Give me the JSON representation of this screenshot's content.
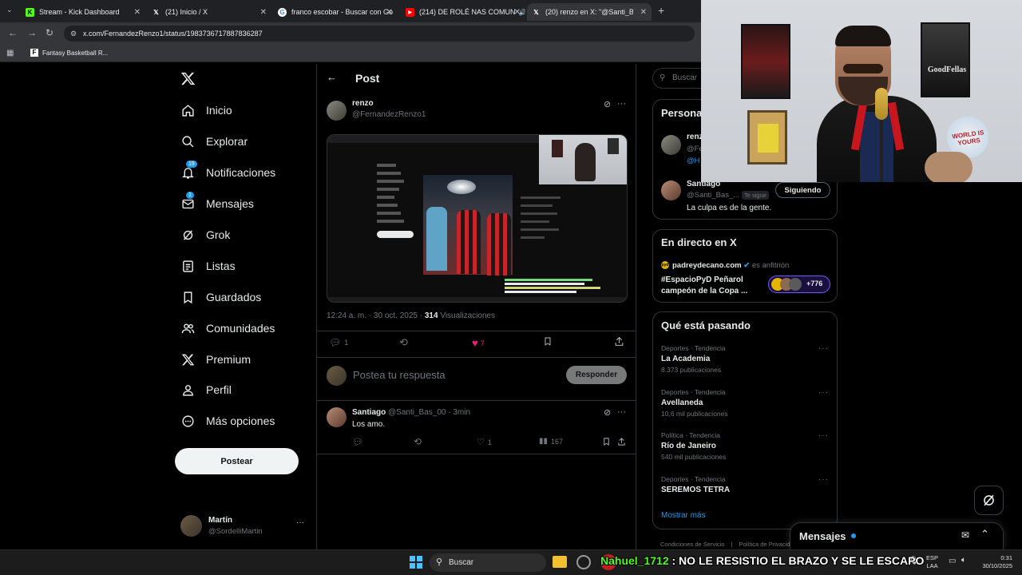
{
  "browser": {
    "tabs": [
      {
        "label": "Stream - Kick Dashboard",
        "favicon": "K",
        "color": "#53fc18"
      },
      {
        "label": "(21) Inicio / X",
        "favicon": "X",
        "color": "#000000"
      },
      {
        "label": "franco escobar - Buscar con Go",
        "favicon": "G",
        "color": "#ffffff"
      },
      {
        "label": "(214) DE ROLÉ NAS COMUN",
        "favicon": "▶",
        "color": "#ff0000"
      },
      {
        "label": "(20) renzo en X: \"@Santi_Bas_0",
        "favicon": "X",
        "color": "#000000"
      }
    ],
    "url": "x.com/FernandezRenzo1/status/1983736717887836287",
    "bookmark": "Fantasy Basketball R..."
  },
  "nav": {
    "items": [
      {
        "label": "Inicio",
        "icon": "home-icon"
      },
      {
        "label": "Explorar",
        "icon": "search-icon"
      },
      {
        "label": "Notificaciones",
        "icon": "bell-icon",
        "badge": "19"
      },
      {
        "label": "Mensajes",
        "icon": "mail-icon",
        "badge": "1"
      },
      {
        "label": "Grok",
        "icon": "grok-icon"
      },
      {
        "label": "Listas",
        "icon": "list-icon"
      },
      {
        "label": "Guardados",
        "icon": "bookmark-icon"
      },
      {
        "label": "Comunidades",
        "icon": "people-icon"
      },
      {
        "label": "Premium",
        "icon": "x-icon"
      },
      {
        "label": "Perfil",
        "icon": "person-icon"
      },
      {
        "label": "Más opciones",
        "icon": "more-icon"
      }
    ],
    "post_button": "Postear",
    "account": {
      "name": "Martín",
      "handle": "@SordelliMartin"
    }
  },
  "post": {
    "header": "Post",
    "author": {
      "name": "renzo",
      "handle": "@FernandezRenzo1"
    },
    "meta": {
      "time": "12:24 a. m. · 30 oct. 2025 · ",
      "views": "314",
      "views_label": " Visualizaciones"
    },
    "stats": {
      "replies": "1",
      "likes": "7"
    },
    "reply_placeholder": "Postea tu respuesta",
    "reply_button": "Responder"
  },
  "reply": {
    "name": "Santiago",
    "handle": "@Santi_Bas_00 · 3min",
    "text": "Los amo.",
    "likes": "1",
    "views": "167"
  },
  "right": {
    "search_placeholder": "Buscar",
    "people_title": "Persona",
    "person1": {
      "name": "renz",
      "handle": "@Fe",
      "link": "@H"
    },
    "person2": {
      "name": "Santiago",
      "handle": "@Santi_Bas_...",
      "follows_you": "Te sigue",
      "button": "Siguiendo",
      "bio": "La culpa es de la gente."
    },
    "live": {
      "title": "En directo en X",
      "host": "padreydecano.com",
      "host_role": "es anfitrión",
      "space": "#EspacioPyD Peñarol campeón de la Copa ...",
      "listeners": "+776"
    },
    "trends_title": "Qué está pasando",
    "trends": [
      {
        "category": "Deportes · Tendencia",
        "name": "La Academia",
        "count": "8.373 publicaciones"
      },
      {
        "category": "Deportes · Tendencia",
        "name": "Avellaneda",
        "count": "10,6 mil publicaciones"
      },
      {
        "category": "Política · Tendencia",
        "name": "Río de Janeiro",
        "count": "540 mil publicaciones"
      },
      {
        "category": "Deportes · Tendencia",
        "name": "SEREMOS TETRA",
        "count": ""
      }
    ],
    "show_more": "Mostrar más",
    "footer": [
      "Condiciones de Servicio",
      "Política de Privacidad"
    ],
    "messages": "Mensajes"
  },
  "taskbar": {
    "search": "Buscar",
    "chat_user": "Nahuel_1712",
    "chat_message": " : NO LE RESISTIO EL BRAZO Y SE LE ESCAPO",
    "lang": "ESP",
    "lang2": "LAA",
    "time": "0:31",
    "date": "30/10/2025"
  },
  "colors": {
    "accent": "#1d9bf0",
    "like": "#f91880",
    "kick": "#53fc18"
  }
}
